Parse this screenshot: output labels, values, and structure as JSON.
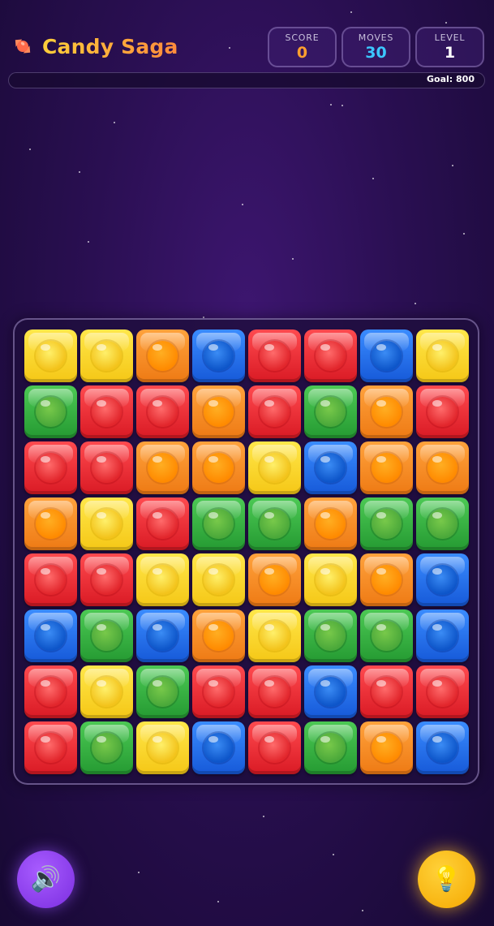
{
  "app": {
    "title": "Candy Saga",
    "logo_icon": "candy-icon"
  },
  "stats": {
    "score": {
      "label": "SCORE",
      "value": "0",
      "color": "#ff9f2e"
    },
    "moves": {
      "label": "MOVES",
      "value": "30",
      "color": "#3cc7ff"
    },
    "level": {
      "label": "LEVEL",
      "value": "1",
      "color": "#ffffff"
    }
  },
  "progress": {
    "text": "Goal: 800",
    "fraction": 0.0
  },
  "board": {
    "rows": 8,
    "cols": 8,
    "tiles": [
      [
        "yellow",
        "yellow",
        "orange",
        "blue",
        "red",
        "red",
        "blue",
        "yellow"
      ],
      [
        "green",
        "red",
        "red",
        "orange",
        "red",
        "green",
        "orange",
        "red"
      ],
      [
        "red",
        "red",
        "orange",
        "orange",
        "yellow",
        "blue",
        "orange",
        "orange"
      ],
      [
        "orange",
        "yellow",
        "red",
        "green",
        "green",
        "orange",
        "green",
        "green"
      ],
      [
        "red",
        "red",
        "yellow",
        "yellow",
        "orange",
        "yellow",
        "orange",
        "blue"
      ],
      [
        "blue",
        "green",
        "blue",
        "orange",
        "yellow",
        "green",
        "green",
        "blue"
      ],
      [
        "red",
        "yellow",
        "green",
        "red",
        "red",
        "blue",
        "red",
        "red"
      ],
      [
        "red",
        "green",
        "yellow",
        "blue",
        "red",
        "green",
        "orange",
        "blue"
      ]
    ],
    "colors": {
      "yellow": "#f5c716",
      "red": "#e2262c",
      "orange": "#ff8a00",
      "blue": "#1659d8",
      "green": "#259a32"
    }
  },
  "buttons": {
    "sound": {
      "icon": "speaker-icon",
      "glyph": "🔊"
    },
    "hint": {
      "icon": "lightbulb-icon",
      "glyph": "💡"
    }
  }
}
